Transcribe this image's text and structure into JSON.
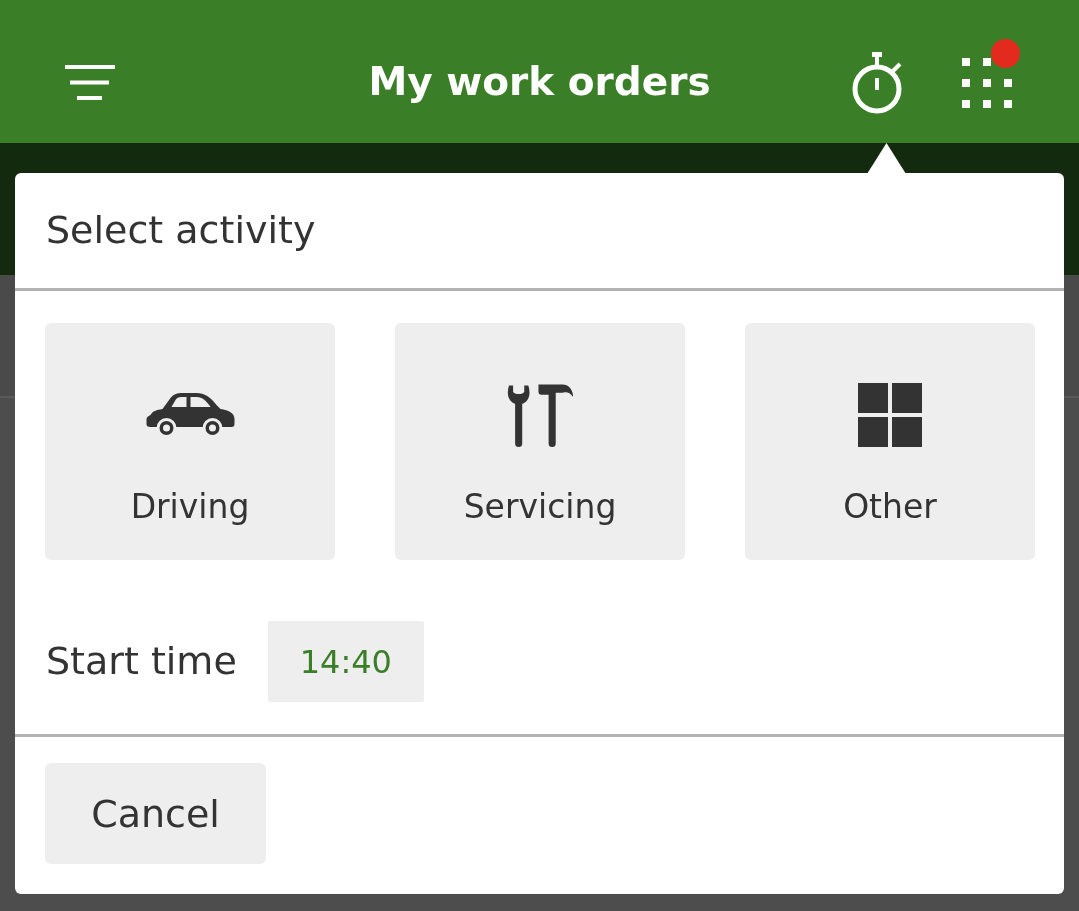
{
  "app_bar": {
    "title": "My work orders",
    "notification_badge": true
  },
  "activity_popover": {
    "title": "Select activity",
    "activities": [
      {
        "label": "Driving",
        "kind": "car"
      },
      {
        "label": "Servicing",
        "kind": "tools"
      },
      {
        "label": "Other",
        "kind": "grid"
      }
    ],
    "start_time": {
      "label": "Start time",
      "value": "14:40"
    },
    "buttons": [
      "Cancel"
    ]
  }
}
